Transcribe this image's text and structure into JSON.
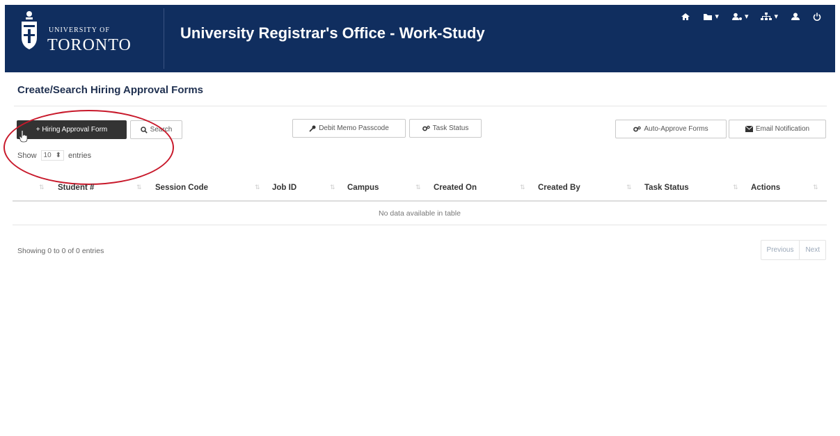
{
  "header": {
    "logo_line1": "UNIVERSITY OF",
    "logo_line2": "TORONTO",
    "title": "University Registrar's Office - Work-Study",
    "nav_icons": [
      "home-icon",
      "folder-icon",
      "user-settings-icon",
      "sitemap-icon",
      "user-icon",
      "power-icon"
    ]
  },
  "page": {
    "title": "Create/Search Hiring Approval Forms"
  },
  "toolbar": {
    "hiring_form_label": "+ Hiring Approval Form",
    "search_label": "Search",
    "debit_memo_label": "Debit Memo Passcode",
    "task_status_label": "Task Status",
    "auto_approve_label": "Auto-Approve Forms",
    "email_notification_label": "Email Notification"
  },
  "length": {
    "show": "Show",
    "value": "10",
    "entries": "entries"
  },
  "table": {
    "columns": [
      "Student #",
      "Session Code",
      "Job ID",
      "Campus",
      "Created On",
      "Created By",
      "Task Status",
      "Actions"
    ],
    "empty_message": "No data available in table"
  },
  "footer": {
    "info": "Showing 0 to 0 of 0 entries",
    "previous": "Previous",
    "next": "Next"
  },
  "colors": {
    "header_bg": "#102e5f",
    "annotation_red": "#c8192b",
    "dark_button": "#333333"
  }
}
